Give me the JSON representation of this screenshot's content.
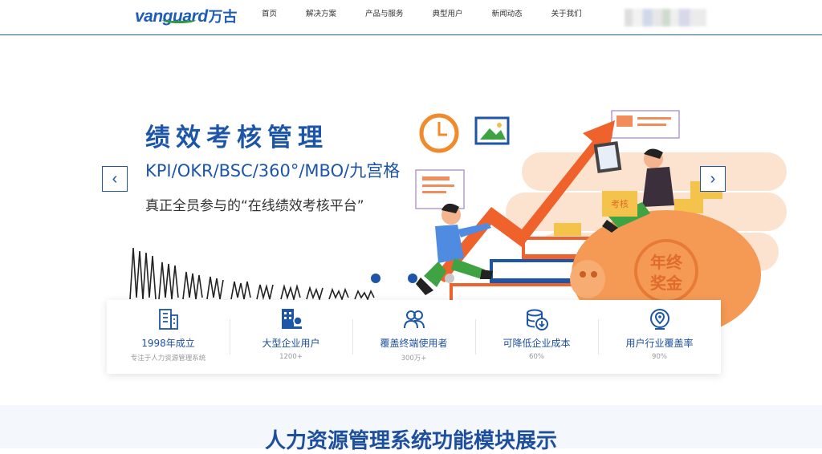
{
  "brand": {
    "logo_en": "vanguard",
    "logo_cn": "万古",
    "color": "#1d5cb8"
  },
  "nav": {
    "items": [
      {
        "label": "首页"
      },
      {
        "label": "解决方案"
      },
      {
        "label": "产品与服务"
      },
      {
        "label": "典型用户"
      },
      {
        "label": "新闻动态"
      },
      {
        "label": "关于我们"
      }
    ]
  },
  "banner": {
    "headline": "绩效考核管理",
    "subline": "KPI/OKR/BSC/360°/MBO/九宫格",
    "tagline": "真正全员参与的“在线绩效考核平台”",
    "prev_icon": "chevron-left-icon",
    "next_icon": "chevron-right-icon",
    "prev_glyph": "‹",
    "next_glyph": "›",
    "slide_count": 3,
    "active_slide": 1,
    "art": {
      "book_label": "考核",
      "pig_label_line1": "年终",
      "pig_label_line2": "奖金"
    }
  },
  "stats": [
    {
      "icon": "building-icon",
      "title": "1998年成立",
      "sub": "专注于人力资源管理系统"
    },
    {
      "icon": "enterprise-user-icon",
      "title": "大型企业用户",
      "sub": "1200+"
    },
    {
      "icon": "users-icon",
      "title": "覆盖终端使用者",
      "sub": "300万+"
    },
    {
      "icon": "cost-reduction-icon",
      "title": "可降低企业成本",
      "sub": "60%"
    },
    {
      "icon": "location-coverage-icon",
      "title": "用户行业覆盖率",
      "sub": "90%"
    }
  ],
  "section": {
    "title": "人力资源管理系统功能模块展示"
  },
  "colors": {
    "primary": "#1d56a8",
    "accent_orange": "#f0622c",
    "accent_green": "#3fa343"
  }
}
